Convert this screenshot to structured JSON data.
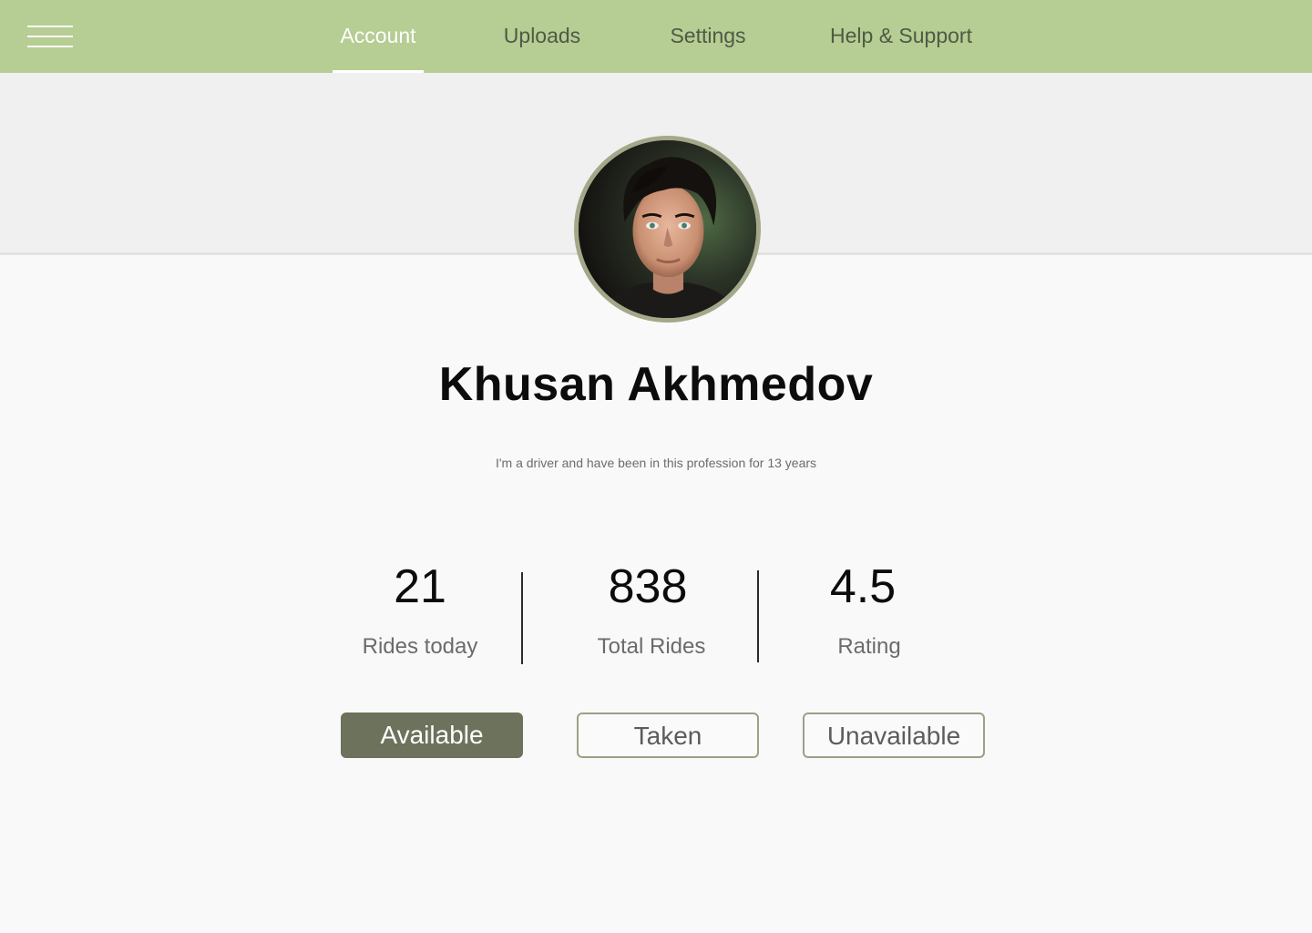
{
  "nav": {
    "menu_icon": "hamburger-menu-icon",
    "tabs": [
      {
        "label": "Account",
        "active": true
      },
      {
        "label": "Uploads",
        "active": false
      },
      {
        "label": "Settings",
        "active": false
      },
      {
        "label": "Help & Support",
        "active": false
      }
    ]
  },
  "profile": {
    "name": "Khusan Akhmedov",
    "bio": "I'm a driver and have been in this profession for 13 years"
  },
  "stats": [
    {
      "value": "21",
      "label": "Rides today"
    },
    {
      "value": "838",
      "label": "Total Rides"
    },
    {
      "value": "4.5",
      "label": "Rating"
    }
  ],
  "status_buttons": {
    "selected": "Available",
    "available": "Available",
    "taken": "Taken",
    "unavailable": "Unavailable"
  },
  "colors": {
    "header": "#b6cd93",
    "accent": "#6c725b",
    "border": "#9d9f86"
  }
}
